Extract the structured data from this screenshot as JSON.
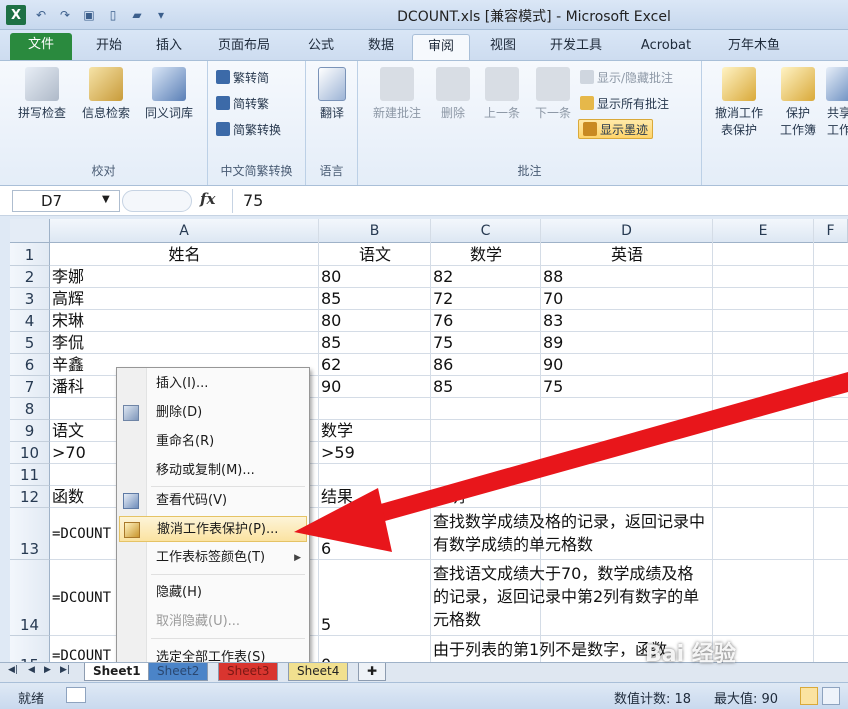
{
  "window": {
    "title": "DCOUNT.xls  [兼容模式]  -  Microsoft Excel",
    "app_icon": "X"
  },
  "tabs": [
    "文件",
    "开始",
    "插入",
    "页面布局",
    "公式",
    "数据",
    "审阅",
    "视图",
    "开发工具",
    "Acrobat",
    "万年木鱼"
  ],
  "ribbon": {
    "proofing": {
      "spell": "拼写检查",
      "research": "信息检索",
      "thesaurus": "同义词库",
      "label": "校对"
    },
    "chinese": {
      "t2s": "繁转简",
      "s2t": "简转繁",
      "convert": "简繁转换",
      "label": "中文简繁转换"
    },
    "language": {
      "translate": "翻译",
      "label": "语言"
    },
    "comments": {
      "new": "新建批注",
      "delete": "删除",
      "prev": "上一条",
      "next": "下一条",
      "showhide": "显示/隐藏批注",
      "showall": "显示所有批注",
      "ink": "显示墨迹",
      "label": "批注"
    },
    "changes": {
      "unprotect_line1": "撤消工作",
      "unprotect_line2": "表保护",
      "protect_line1": "保护",
      "protect_line2": "工作簿",
      "share_line1": "共享",
      "share_line2": "工作"
    }
  },
  "formula_bar": {
    "name_box": "D7",
    "fx": "fx",
    "value": "75"
  },
  "columns": [
    "A",
    "B",
    "C",
    "D",
    "E",
    "F"
  ],
  "rows": [
    "1",
    "2",
    "3",
    "4",
    "5",
    "6",
    "7",
    "8",
    "9",
    "10",
    "11",
    "12",
    "13",
    "14",
    "15"
  ],
  "cells": {
    "A1": "姓名",
    "B1": "语文",
    "C1": "数学",
    "D1": "英语",
    "A2": "李娜",
    "B2": "80",
    "C2": "82",
    "D2": "88",
    "A3": "高辉",
    "B3": "85",
    "C3": "72",
    "D3": "70",
    "A4": "宋琳",
    "B4": "80",
    "C4": "76",
    "D4": "83",
    "A5": "李侃",
    "B5": "85",
    "C5": "75",
    "D5": "89",
    "A6": "辛鑫",
    "B6": "62",
    "C6": "86",
    "D6": "90",
    "A7": "潘科",
    "B7": "90",
    "C7": "85",
    "D7": "75",
    "A9": "语文",
    "B9": "数学",
    "A10": ">70",
    "B10": ">59",
    "A12": "函数",
    "B12": "结果",
    "C12": "说明",
    "A13": "=DCOUNT",
    "B13": "6",
    "C13": "查找数学成绩及格的记录，返回记录中有数学成绩的单元格数",
    "A14": "=DCOUNT",
    "B14": "5",
    "C14": "查找语文成绩大于70，数学成绩及格的记录，返回记录中第2列有数字的单元格数",
    "A15": "=DCOUNT",
    "B15": "0",
    "C15": "由于列表的第1列不是数字，函数"
  },
  "context_menu": {
    "insert": "插入(I)...",
    "delete": "删除(D)",
    "rename": "重命名(R)",
    "move_copy": "移动或复制(M)...",
    "view_code": "查看代码(V)",
    "unprotect": "撤消工作表保护(P)...",
    "tab_color": "工作表标签颜色(T)",
    "hide": "隐藏(H)",
    "unhide": "取消隐藏(U)...",
    "select_all": "选定全部工作表(S)"
  },
  "sheets": [
    "Sheet1",
    "Sheet2",
    "Sheet3",
    "Sheet4"
  ],
  "status": {
    "ready": "就绪",
    "count": "数值计数: 18",
    "max": "最大值: 90"
  },
  "watermark": "Bai 经验",
  "colors": {
    "file_tab": "#2a8a3e",
    "arrow": "#e8161b",
    "highlight": "#fbe3a1"
  }
}
